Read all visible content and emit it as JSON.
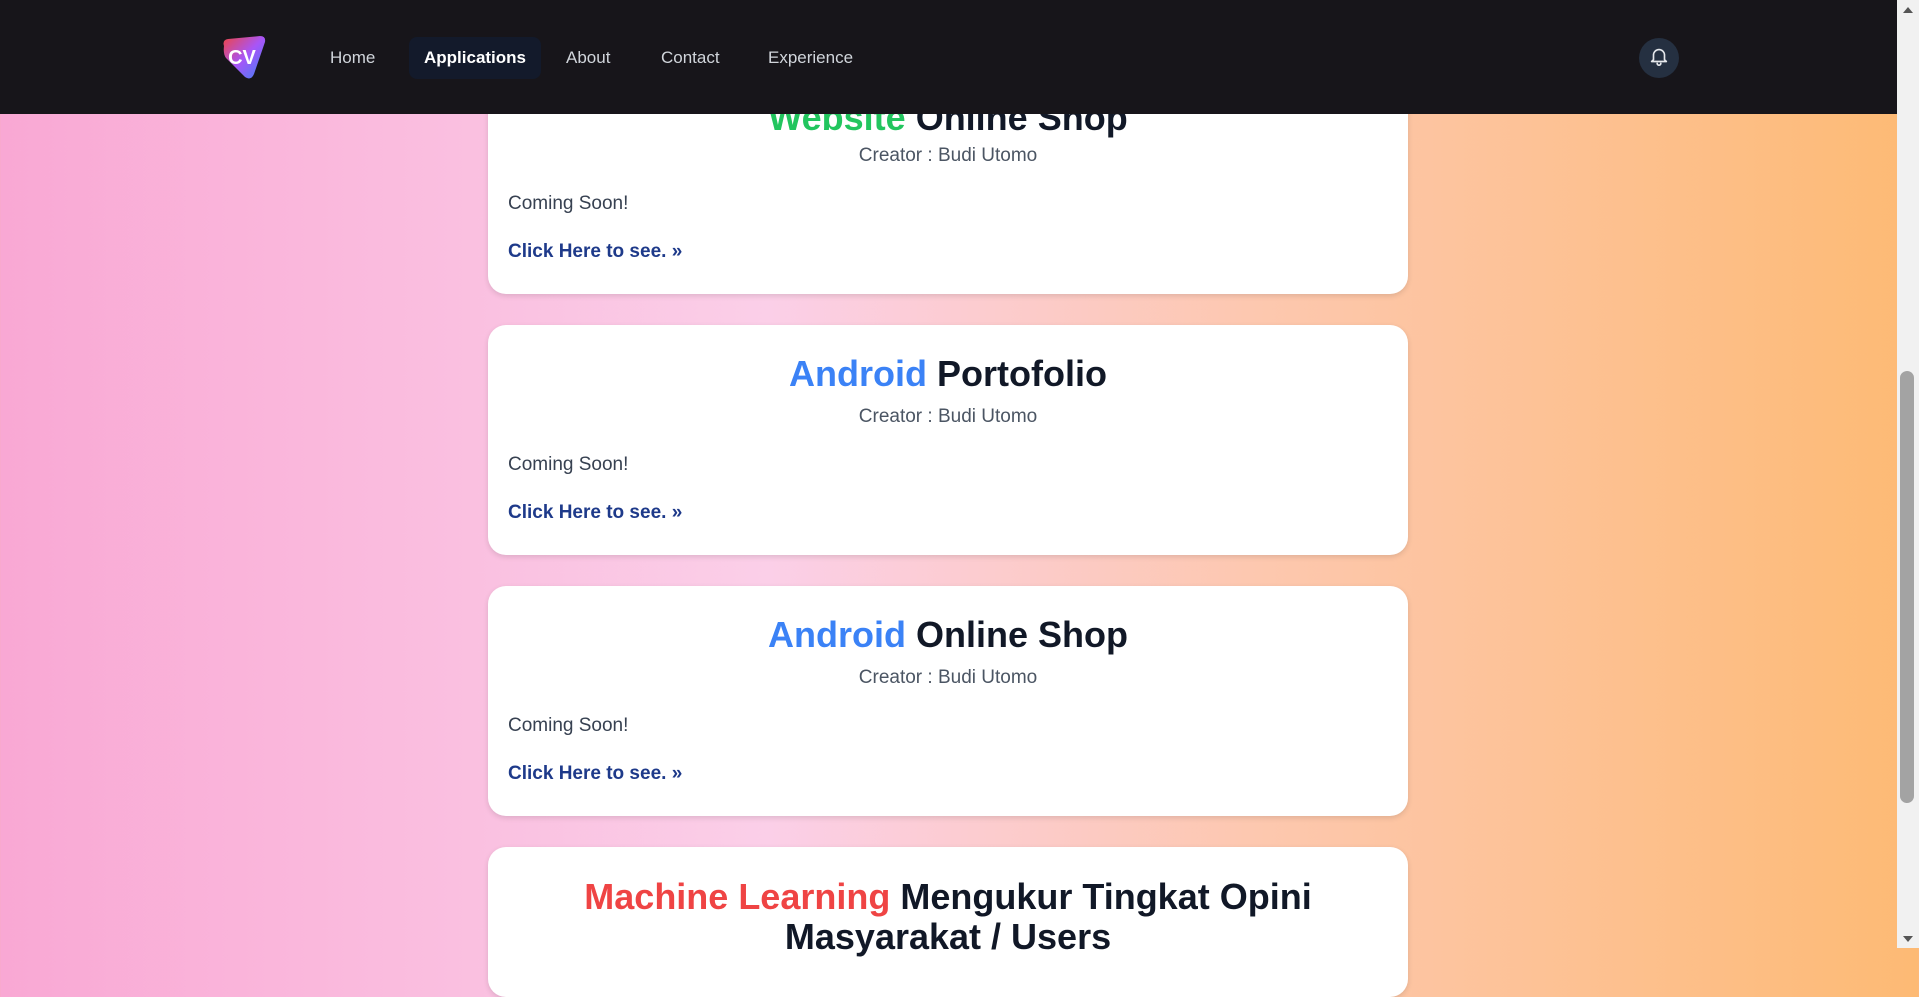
{
  "nav": {
    "logo_text": "CV",
    "links": [
      "Home",
      "Applications",
      "About",
      "Contact",
      "Experience"
    ],
    "active": "Applications"
  },
  "cards": [
    {
      "tag": "Website",
      "title": "Online Shop",
      "creator": "Creator : Budi Utomo",
      "desc": "Coming Soon!",
      "link": "Click Here to see. »"
    },
    {
      "tag": "Android",
      "title": "Portofolio",
      "creator": "Creator : Budi Utomo",
      "desc": "Coming Soon!",
      "link": "Click Here to see. »"
    },
    {
      "tag": "Android",
      "title": "Online Shop",
      "creator": "Creator : Budi Utomo",
      "desc": "Coming Soon!",
      "link": "Click Here to see. »"
    },
    {
      "tag": "Machine Learning",
      "title_line1": "Mengukur Tingkat Opini",
      "title_line2": "Masyarakat / Users"
    }
  ],
  "colors": {
    "website": "#22c55e",
    "android": "#3b82f6",
    "machine_learning": "#ef4444",
    "link": "#1e3a8a",
    "navbar": "#17151a"
  }
}
